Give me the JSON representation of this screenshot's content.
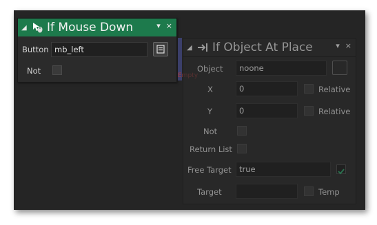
{
  "panel_mouse": {
    "title": "If Mouse Down",
    "button_label": "Button",
    "button_value": "mb_left",
    "not_label": "Not",
    "collapse_glyph": "◢",
    "menu_glyph": "▾",
    "close_glyph": "×"
  },
  "empty_label": "Empty",
  "panel_object": {
    "title": "If Object At Place",
    "collapse_glyph": "◢",
    "menu_glyph": "▾",
    "close_glyph": "×",
    "object_label": "Object",
    "object_value": "noone",
    "x_label": "X",
    "x_value": "0",
    "x_relative": "Relative",
    "y_label": "Y",
    "y_value": "0",
    "y_relative": "Relative",
    "not_label": "Not",
    "return_list_label": "Return List",
    "free_target_label": "Free Target",
    "free_target_value": "true",
    "target_label": "Target",
    "target_value": "",
    "temp_label": "Temp"
  },
  "colors": {
    "header_active": "#1d7a4c",
    "canvas_bg": "#252525",
    "empty_text": "#a63a3a"
  }
}
